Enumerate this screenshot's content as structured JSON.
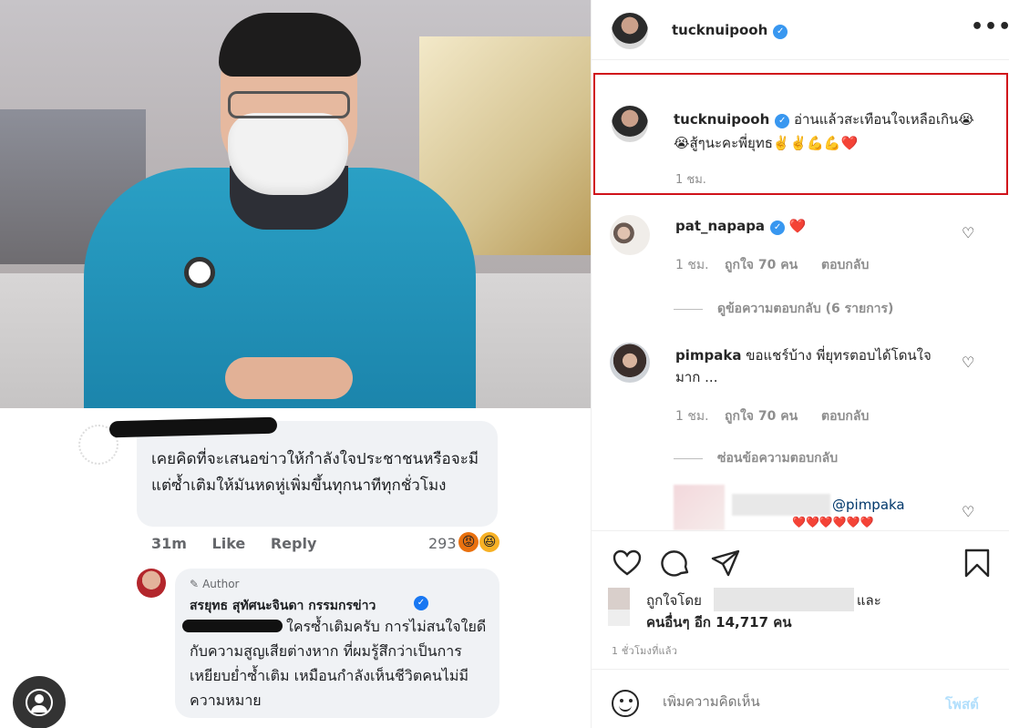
{
  "post": {
    "username": "tucknuipooh"
  },
  "caption": {
    "username": "tucknuipooh",
    "text": "อ่านแล้วสะเทือนใจเหลือเกิน😭😭สู้ๆนะคะพี่ยุทธ✌️✌️💪💪❤️",
    "time": "1 ชม."
  },
  "comments": [
    {
      "username": "pat_napapa",
      "text": "❤️",
      "time": "1 ชม.",
      "likes": "ถูกใจ 70 คน",
      "reply": "ตอบกลับ",
      "thread_link": "ดูข้อความตอบกลับ (6 รายการ)"
    },
    {
      "username": "pimpaka",
      "text": "ขอแชร์บ้าง พี่ยุทรตอบได้โดนใจ มาก ...",
      "time": "1 ชม.",
      "likes": "ถูกใจ 70 คน",
      "reply": "ตอบกลับ",
      "thread_link": "ซ่อนข้อความตอบกลับ"
    }
  ],
  "reply_preview": {
    "mention": "@pimpaka",
    "text": "❤️❤️❤️❤️❤️❤️"
  },
  "likes": {
    "prefix": "ถูกใจโดย",
    "suffix": "และ",
    "others": "คนอื่นๆ อีก 14,717 คน"
  },
  "ago": "1 ชั่วโมงที่แล้ว",
  "add_comment": {
    "placeholder": "เพิ่มความคิดเห็น",
    "post_label": "โพสต์"
  },
  "embedded_fb": {
    "comment1_text": "เคยคิดที่จะเสนอข่าวให้กำลังใจประชาชนหรือจะมีแต่ซ้ำเติมให้มันหดหู่เพิ่มขึ้นทุกนาทีทุกชั่วโมง",
    "comment1_time": "31m",
    "like": "Like",
    "reply": "Reply",
    "comment1_count": "293",
    "author_tag": "Author",
    "author_name": "สรยุทธ สุทัศนะจินดา กรรมกรข่าว",
    "comment2_text": "ใครซ้ำเติมครับ การไม่สนใจใยดีกับความสูญเสียต่างหาก ที่ผมรู้สึกว่าเป็นการเหยียบย่ำซ้ำเติม เหมือนกำลังเห็นชีวิตคนไม่มีความหมาย"
  },
  "icons": {
    "more": "more-options-icon",
    "like": "heart-icon",
    "comment": "comment-icon",
    "share": "share-icon",
    "save": "bookmark-icon",
    "emoji": "emoji-icon"
  },
  "colors": {
    "highlight": "#d0121a",
    "verified": "#3897f0",
    "post_btn_disabled": "#b2dffc"
  }
}
